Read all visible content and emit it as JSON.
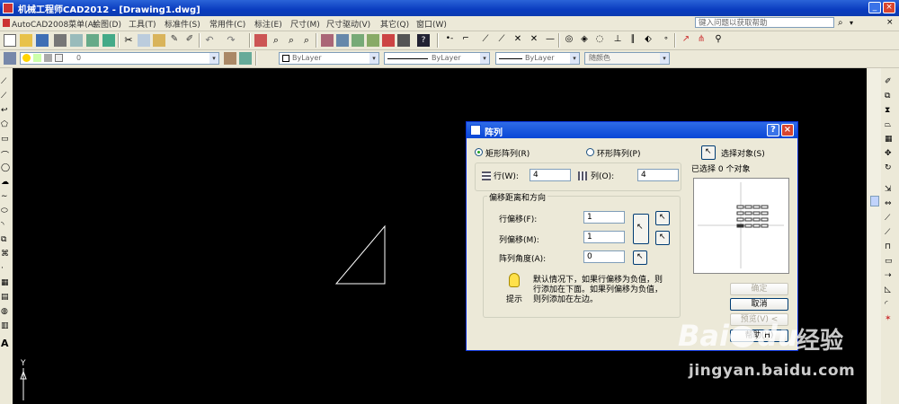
{
  "window": {
    "title": "机械工程师CAD2012 - [Drawing1.dwg]",
    "minimize": "_",
    "close": "×"
  },
  "menubar": {
    "items": [
      "AutoCAD2008菜单(A)",
      "绘图(D)",
      "工具(T)",
      "标准件(S)",
      "常用件(C)",
      "标注(E)",
      "尺寸(M)",
      "尺寸驱动(V)",
      "其它(Q)",
      "窗口(W)"
    ],
    "help_placeholder": "键入问题以获取帮助"
  },
  "toolbar2": {
    "layer_value": "0",
    "color_value": "ByLayer",
    "linetype_value": "ByLayer",
    "lineweight_value": "ByLayer",
    "plotstyle_value": "随颜色"
  },
  "dialog": {
    "title": "阵列",
    "help_btn": "?",
    "close_btn": "×",
    "rect_array_label": "矩形阵列(R)",
    "polar_array_label": "环形阵列(P)",
    "select_objects_label": "选择对象(S)",
    "selected_count_text": "已选择 0 个对象",
    "rows_label": "行(W):",
    "rows_value": "4",
    "cols_label": "列(O):",
    "cols_value": "4",
    "offset_group_label": "偏移距离和方向",
    "row_offset_label": "行偏移(F):",
    "row_offset_value": "1",
    "col_offset_label": "列偏移(M):",
    "col_offset_value": "1",
    "angle_label": "阵列角度(A):",
    "angle_value": "0",
    "tip_text_1": "默认情况下，如果行偏移为负值，则",
    "tip_text_2": "行添加在下面。如果列偏移为负值，",
    "tip_text_3": "则列添加在左边。",
    "tip_label": "提示",
    "ok_btn": "确定",
    "cancel_btn": "取消",
    "preview_btn": "预览(V) <",
    "help_button": "帮助(H)"
  },
  "canvas": {
    "ucs_y_label": "Y"
  },
  "watermark": {
    "brand_a": "Bai",
    "brand_b": "du",
    "brand_cn": "经验",
    "url": "jingyan.baidu.com"
  },
  "colors": {
    "titlebar": "#0a3cbf",
    "chrome": "#ECE9D8",
    "canvas": "#000000",
    "close_red": "#d8452f"
  }
}
